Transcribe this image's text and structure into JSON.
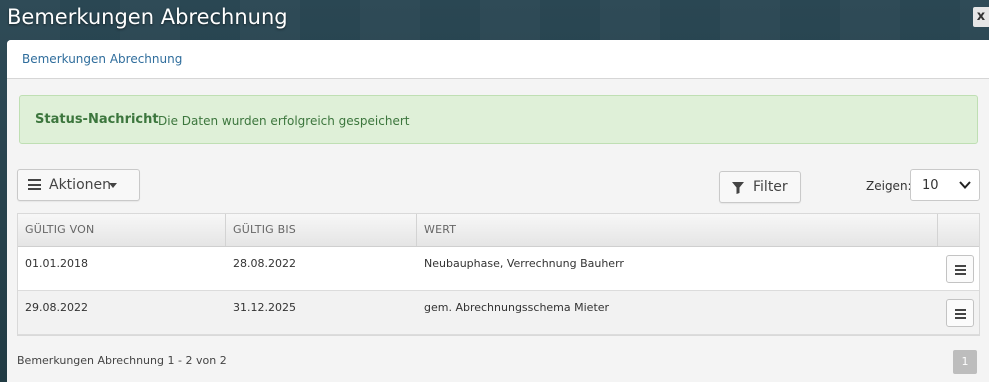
{
  "window": {
    "title": "Bemerkungen Abrechnung",
    "close_label": "x"
  },
  "panel": {
    "heading": "Bemerkungen Abrechnung"
  },
  "alert": {
    "title": "Status-Nachricht",
    "message": "Die Daten wurden erfolgreich gespeichert"
  },
  "toolbar": {
    "actions_label": "Aktionen",
    "filter_label": "Filter",
    "show_label": "Zeigen:",
    "page_size": "10"
  },
  "table": {
    "columns": [
      "GÜLTIG VON",
      "GÜLTIG BIS",
      "WERT"
    ],
    "rows": [
      {
        "from": "01.01.2018",
        "to": "28.08.2022",
        "value": "Neubauphase, Verrechnung Bauherr"
      },
      {
        "from": "29.08.2022",
        "to": "31.12.2025",
        "value": "gem. Abrechnungsschema Mieter"
      }
    ]
  },
  "footer": {
    "summary_prefix": "Bemerkungen Abrechnung",
    "summary_range": "1 - 2",
    "summary_of": "von",
    "summary_total": "2",
    "current_page": "1"
  },
  "icons": {
    "menu": "hamburger-icon",
    "filter": "filter-icon",
    "caret": "caret-down-icon",
    "chevron": "chevron-down-icon",
    "close": "close-icon"
  },
  "colors": {
    "link": "#2f6d9c",
    "success_bg": "#dff0d8",
    "success_text": "#3c763d",
    "pager_bg": "#bdbdbd"
  }
}
